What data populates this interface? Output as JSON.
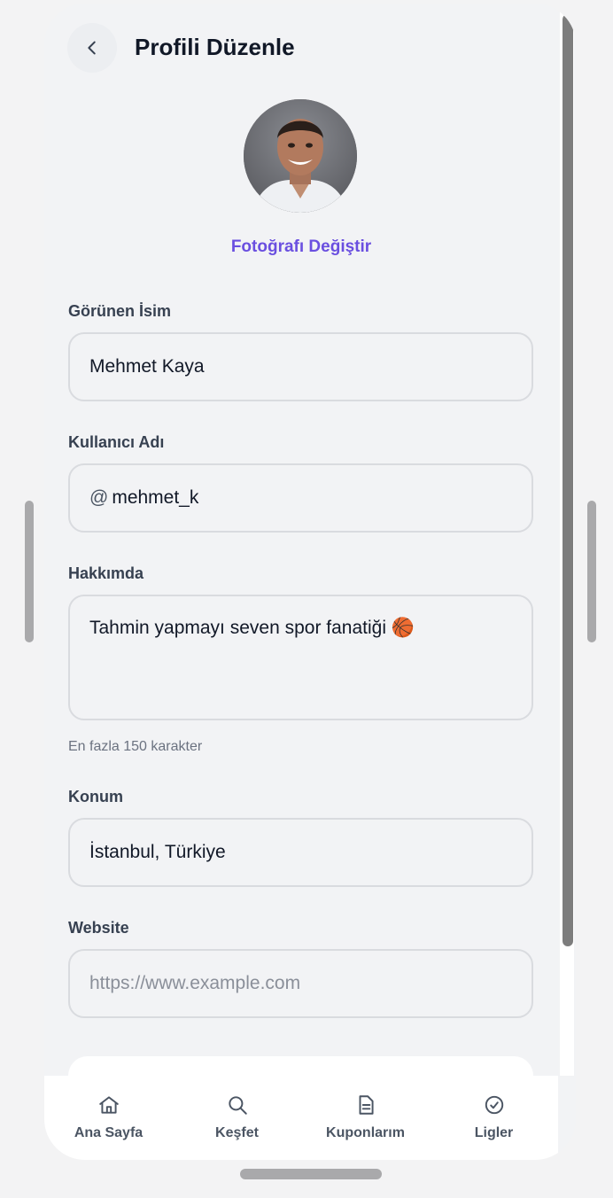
{
  "header": {
    "title": "Profili Düzenle"
  },
  "profile": {
    "change_photo_label": "Fotoğrafı Değiştir"
  },
  "form": {
    "display_name": {
      "label": "Görünen İsim",
      "value": "Mehmet Kaya"
    },
    "username": {
      "label": "Kullanıcı Adı",
      "prefix": "@",
      "value": "mehmet_k"
    },
    "about": {
      "label": "Hakkımda",
      "value": "Tahmin yapmayı seven spor fanatiği 🏀",
      "hint": "En fazla 150 karakter"
    },
    "location": {
      "label": "Konum",
      "value": "İstanbul, Türkiye"
    },
    "website": {
      "label": "Website",
      "placeholder": "https://www.example.com"
    }
  },
  "bottom_nav": {
    "items": [
      {
        "label": "Ana Sayfa",
        "icon": "home-icon"
      },
      {
        "label": "Keşfet",
        "icon": "search-icon"
      },
      {
        "label": "Kuponlarım",
        "icon": "document-icon"
      },
      {
        "label": "Ligler",
        "icon": "badge-check-icon"
      }
    ]
  },
  "colors": {
    "accent": "#6a4fe0",
    "text_primary": "#111827",
    "background": "#f2f3f5"
  }
}
